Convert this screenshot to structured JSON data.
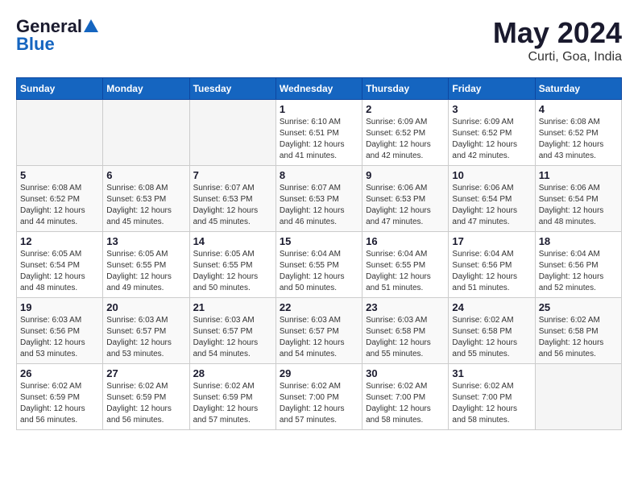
{
  "header": {
    "logo_line1": "General",
    "logo_line2": "Blue",
    "title": "May 2024",
    "subtitle": "Curti, Goa, India"
  },
  "calendar": {
    "days_of_week": [
      "Sunday",
      "Monday",
      "Tuesday",
      "Wednesday",
      "Thursday",
      "Friday",
      "Saturday"
    ],
    "weeks": [
      [
        {
          "day": "",
          "info": ""
        },
        {
          "day": "",
          "info": ""
        },
        {
          "day": "",
          "info": ""
        },
        {
          "day": "1",
          "info": "Sunrise: 6:10 AM\nSunset: 6:51 PM\nDaylight: 12 hours\nand 41 minutes."
        },
        {
          "day": "2",
          "info": "Sunrise: 6:09 AM\nSunset: 6:52 PM\nDaylight: 12 hours\nand 42 minutes."
        },
        {
          "day": "3",
          "info": "Sunrise: 6:09 AM\nSunset: 6:52 PM\nDaylight: 12 hours\nand 42 minutes."
        },
        {
          "day": "4",
          "info": "Sunrise: 6:08 AM\nSunset: 6:52 PM\nDaylight: 12 hours\nand 43 minutes."
        }
      ],
      [
        {
          "day": "5",
          "info": "Sunrise: 6:08 AM\nSunset: 6:52 PM\nDaylight: 12 hours\nand 44 minutes."
        },
        {
          "day": "6",
          "info": "Sunrise: 6:08 AM\nSunset: 6:53 PM\nDaylight: 12 hours\nand 45 minutes."
        },
        {
          "day": "7",
          "info": "Sunrise: 6:07 AM\nSunset: 6:53 PM\nDaylight: 12 hours\nand 45 minutes."
        },
        {
          "day": "8",
          "info": "Sunrise: 6:07 AM\nSunset: 6:53 PM\nDaylight: 12 hours\nand 46 minutes."
        },
        {
          "day": "9",
          "info": "Sunrise: 6:06 AM\nSunset: 6:53 PM\nDaylight: 12 hours\nand 47 minutes."
        },
        {
          "day": "10",
          "info": "Sunrise: 6:06 AM\nSunset: 6:54 PM\nDaylight: 12 hours\nand 47 minutes."
        },
        {
          "day": "11",
          "info": "Sunrise: 6:06 AM\nSunset: 6:54 PM\nDaylight: 12 hours\nand 48 minutes."
        }
      ],
      [
        {
          "day": "12",
          "info": "Sunrise: 6:05 AM\nSunset: 6:54 PM\nDaylight: 12 hours\nand 48 minutes."
        },
        {
          "day": "13",
          "info": "Sunrise: 6:05 AM\nSunset: 6:55 PM\nDaylight: 12 hours\nand 49 minutes."
        },
        {
          "day": "14",
          "info": "Sunrise: 6:05 AM\nSunset: 6:55 PM\nDaylight: 12 hours\nand 50 minutes."
        },
        {
          "day": "15",
          "info": "Sunrise: 6:04 AM\nSunset: 6:55 PM\nDaylight: 12 hours\nand 50 minutes."
        },
        {
          "day": "16",
          "info": "Sunrise: 6:04 AM\nSunset: 6:55 PM\nDaylight: 12 hours\nand 51 minutes."
        },
        {
          "day": "17",
          "info": "Sunrise: 6:04 AM\nSunset: 6:56 PM\nDaylight: 12 hours\nand 51 minutes."
        },
        {
          "day": "18",
          "info": "Sunrise: 6:04 AM\nSunset: 6:56 PM\nDaylight: 12 hours\nand 52 minutes."
        }
      ],
      [
        {
          "day": "19",
          "info": "Sunrise: 6:03 AM\nSunset: 6:56 PM\nDaylight: 12 hours\nand 53 minutes."
        },
        {
          "day": "20",
          "info": "Sunrise: 6:03 AM\nSunset: 6:57 PM\nDaylight: 12 hours\nand 53 minutes."
        },
        {
          "day": "21",
          "info": "Sunrise: 6:03 AM\nSunset: 6:57 PM\nDaylight: 12 hours\nand 54 minutes."
        },
        {
          "day": "22",
          "info": "Sunrise: 6:03 AM\nSunset: 6:57 PM\nDaylight: 12 hours\nand 54 minutes."
        },
        {
          "day": "23",
          "info": "Sunrise: 6:03 AM\nSunset: 6:58 PM\nDaylight: 12 hours\nand 55 minutes."
        },
        {
          "day": "24",
          "info": "Sunrise: 6:02 AM\nSunset: 6:58 PM\nDaylight: 12 hours\nand 55 minutes."
        },
        {
          "day": "25",
          "info": "Sunrise: 6:02 AM\nSunset: 6:58 PM\nDaylight: 12 hours\nand 56 minutes."
        }
      ],
      [
        {
          "day": "26",
          "info": "Sunrise: 6:02 AM\nSunset: 6:59 PM\nDaylight: 12 hours\nand 56 minutes."
        },
        {
          "day": "27",
          "info": "Sunrise: 6:02 AM\nSunset: 6:59 PM\nDaylight: 12 hours\nand 56 minutes."
        },
        {
          "day": "28",
          "info": "Sunrise: 6:02 AM\nSunset: 6:59 PM\nDaylight: 12 hours\nand 57 minutes."
        },
        {
          "day": "29",
          "info": "Sunrise: 6:02 AM\nSunset: 7:00 PM\nDaylight: 12 hours\nand 57 minutes."
        },
        {
          "day": "30",
          "info": "Sunrise: 6:02 AM\nSunset: 7:00 PM\nDaylight: 12 hours\nand 58 minutes."
        },
        {
          "day": "31",
          "info": "Sunrise: 6:02 AM\nSunset: 7:00 PM\nDaylight: 12 hours\nand 58 minutes."
        },
        {
          "day": "",
          "info": ""
        }
      ]
    ]
  }
}
